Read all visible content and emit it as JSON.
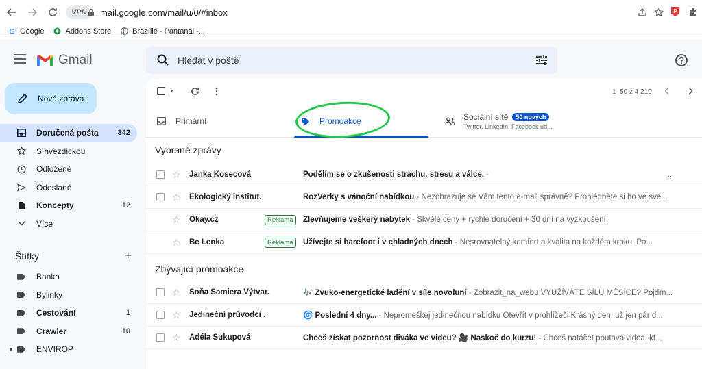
{
  "browser": {
    "vpn": "VPN",
    "url": "mail.google.com/mail/u/0/#inbox",
    "bookmarks": [
      {
        "label": "Google"
      },
      {
        "label": "Addons Store"
      },
      {
        "label": "Brazílie - Pantanal -..."
      }
    ]
  },
  "header": {
    "app_name": "Gmail",
    "search_placeholder": "Hledat v poště"
  },
  "sidebar": {
    "compose_label": "Nová zpráva",
    "items": [
      {
        "label": "Doručená pošta",
        "count": "342"
      },
      {
        "label": "S hvězdičkou",
        "count": ""
      },
      {
        "label": "Odložené",
        "count": ""
      },
      {
        "label": "Odeslané",
        "count": ""
      },
      {
        "label": "Koncepty",
        "count": "12"
      },
      {
        "label": "Více",
        "count": ""
      }
    ],
    "labels_title": "Štítky",
    "add_label": "+",
    "labels": [
      {
        "label": "Banka",
        "count": ""
      },
      {
        "label": "Bylinky",
        "count": ""
      },
      {
        "label": "Cestování",
        "count": "1"
      },
      {
        "label": "Crawler",
        "count": "10"
      },
      {
        "label": "ENVIROP",
        "count": ""
      }
    ]
  },
  "toolbar": {
    "pager": "1–50 z 4 210"
  },
  "tabs": {
    "primary": "Primární",
    "promo": "Promoakce",
    "social": "Sociální sítě",
    "social_badge": "50 nových",
    "social_sub": "Twitter, LinkedIn, Facebook ud..."
  },
  "sections": {
    "featured": "Vybrané zprávy",
    "remaining": "Zbývající promoakce"
  },
  "featured_rows": [
    {
      "sender": "Janka Kosecová",
      "ad": "",
      "subject": "Podělím se o zkušenosti strachu, stresu a válce.",
      "snippet": " -",
      "dots": "..."
    },
    {
      "sender": "Ekologický institut.",
      "ad": "",
      "subject": "RozVerky s vánoční nabídkou",
      "snippet": " - Nezobrazuje se Vám tento e-mail správně? Prohlédněte si ho ve své...",
      "dots": ""
    },
    {
      "sender": "Okay.cz",
      "ad": "Reklama",
      "subject": "Zlevňujeme veškerý nábytek",
      "snippet": " - Skvělé ceny + rychlé doručení + 30 dní na vyzkoušení.",
      "dots": ""
    },
    {
      "sender": "Be Lenka",
      "ad": "Reklama",
      "subject": "Užívejte si barefoot i v chladných dnech",
      "snippet": " - Nesrovnatelný komfort a kvalita na každém kroku. Po...",
      "dots": ""
    }
  ],
  "remaining_rows": [
    {
      "sender": "Soňa Samiera Výtvar.",
      "subject": "🎶 Zvuko-energetické ladění v síle novoluní",
      "snippet": " - Zobrazit_na_webu VYUŽÍVÁTE SÍLU MĚSÍCE? Pojďm..."
    },
    {
      "sender": "Jedineční průvodci .",
      "subject": "🌀 Poslední 4 dny...",
      "snippet": " - Nepromeškej jedinečnou nabídku Otevřít v prohlížeči Krásný den, už jen pár d..."
    },
    {
      "sender": "Adéla Sukupová",
      "subject": "Chceš získat pozornost diváka ve videu? 🎥 Naskoč do kurzu!",
      "snippet": " - Chceš natáčet poutavá videa, kt..."
    }
  ],
  "colors": {
    "accent": "#0b57d0",
    "active_nav": "#d3e3fd",
    "compose": "#c2e7ff",
    "annotation": "#22c94a"
  }
}
